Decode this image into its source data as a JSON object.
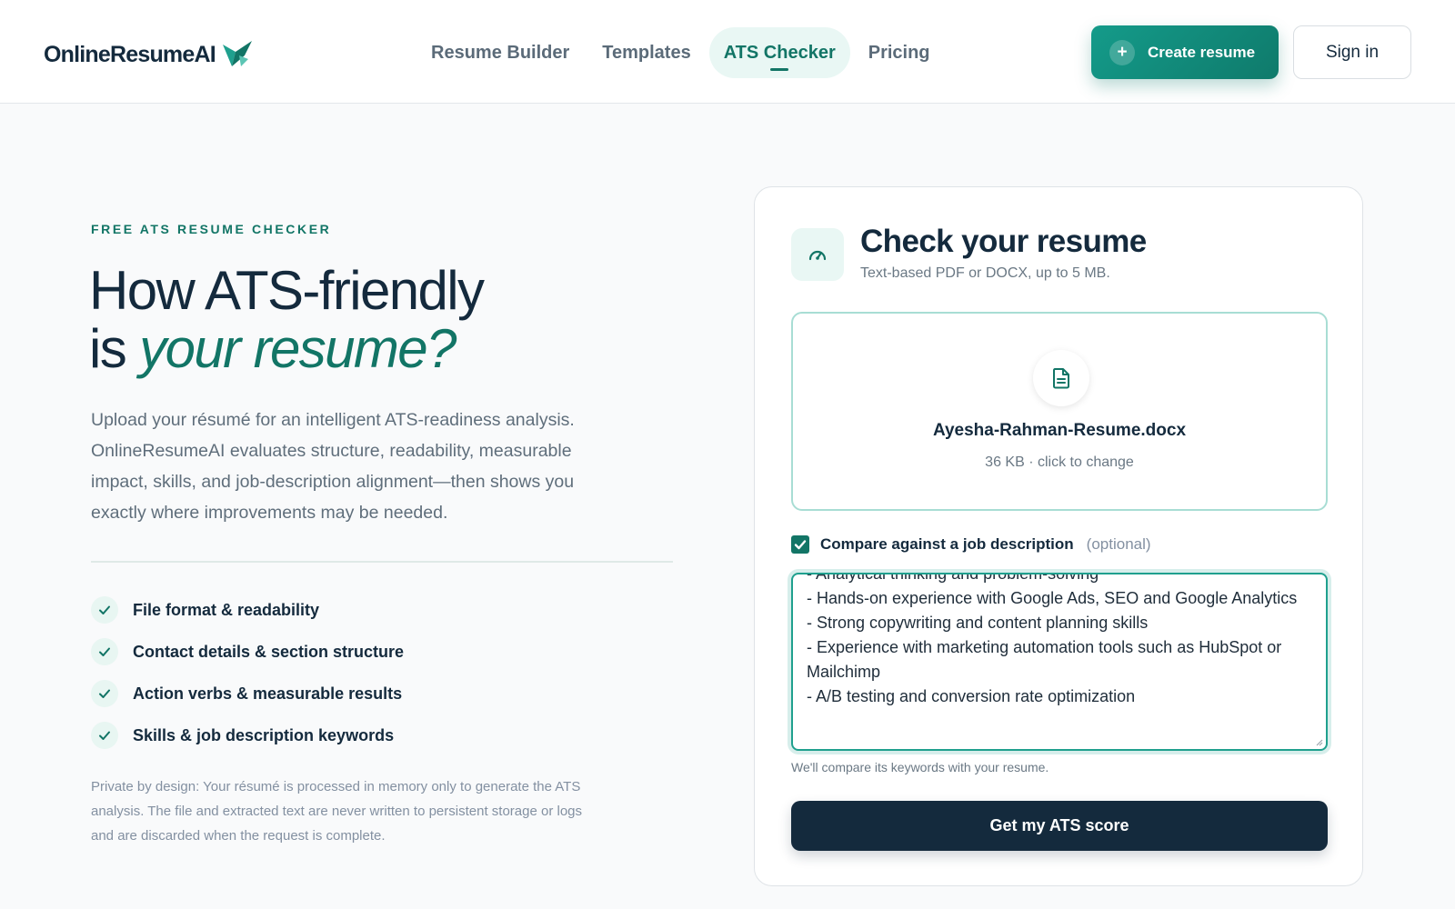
{
  "header": {
    "logo_text": "OnlineResumeAI",
    "nav": [
      {
        "label": "Resume Builder",
        "active": false
      },
      {
        "label": "Templates",
        "active": false
      },
      {
        "label": "ATS Checker",
        "active": true
      },
      {
        "label": "Pricing",
        "active": false
      }
    ],
    "create_label": "Create resume",
    "signin_label": "Sign in"
  },
  "hero": {
    "eyebrow": "FREE ATS RESUME CHECKER",
    "title_line1": "How ATS-friendly",
    "title_line2_prefix": "is ",
    "title_line2_em": "your resume?",
    "lead": "Upload your résumé for an intelligent ATS-readiness analysis. OnlineResumeAI evaluates structure, readability, measurable impact, skills, and job-description alignment—then shows you exactly where improvements may be needed.",
    "features": [
      "File format & readability",
      "Contact details & section structure",
      "Action verbs & measurable results",
      "Skills & job description keywords"
    ],
    "privacy": "Private by design: Your résumé is processed in memory only to generate the ATS analysis. The file and extracted text are never written to persistent storage or logs and are discarded when the request is complete."
  },
  "card": {
    "title": "Check your resume",
    "subtitle": "Text-based PDF or DOCX, up to 5 MB.",
    "file_name": "Ayesha-Rahman-Resume.docx",
    "file_meta": "36 KB · click to change",
    "compare_label": "Compare against a job description",
    "compare_optional": "(optional)",
    "compare_checked": true,
    "job_description": "- Analytical thinking and problem-solving\n- Hands-on experience with Google Ads, SEO and Google Analytics\n- Strong copywriting and content planning skills\n- Experience with marketing automation tools such as HubSpot or Mailchimp\n- A/B testing and conversion rate optimization",
    "helper": "We'll compare its keywords with your resume.",
    "submit_label": "Get my ATS score"
  },
  "colors": {
    "brand": "#127566",
    "navy": "#142a3d",
    "accent_light": "#e9f7f4"
  },
  "icons": [
    "bird-logo-icon",
    "plus-icon",
    "gauge-icon",
    "file-text-icon",
    "check-icon",
    "checkbox-check-icon",
    "resize-handle-icon"
  ]
}
